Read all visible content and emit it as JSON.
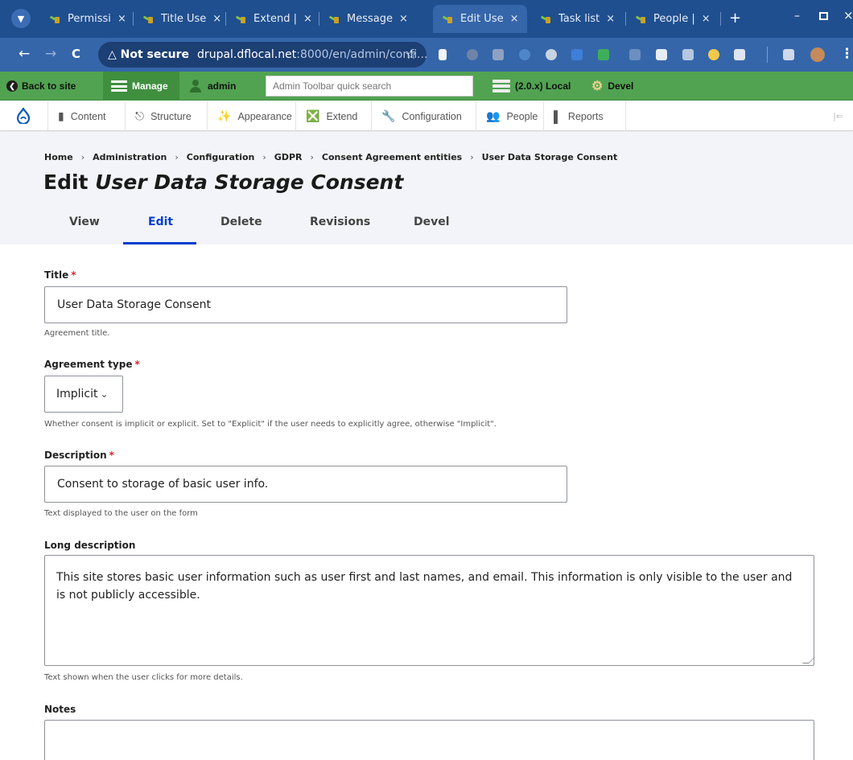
{
  "browser": {
    "tabs": [
      {
        "title": "Permissi",
        "active": false
      },
      {
        "title": "Title Use",
        "active": false
      },
      {
        "title": "Extend |",
        "active": false
      },
      {
        "title": "Message",
        "active": false
      },
      {
        "title": "Edit Use",
        "active": true
      },
      {
        "title": "Task list",
        "active": false
      },
      {
        "title": "People |",
        "active": false
      }
    ],
    "close_glyph": "×",
    "new_tab": "+",
    "security_label": "Not secure",
    "url_host": "drupal.dflocal.net",
    "url_rest": ":8000/en/admin/confi...",
    "bookmark_glyph": "☆",
    "back_glyph": "←",
    "forward_glyph": "→",
    "reload_glyph": "C"
  },
  "admin_toolbar": {
    "back_to_site": "Back to site",
    "manage": "Manage",
    "user": "admin",
    "search_placeholder": "Admin Toolbar quick search",
    "environment": "(2.0.x) Local",
    "devel": "Devel"
  },
  "admin_menu": {
    "items": [
      "Content",
      "Structure",
      "Appearance",
      "Extend",
      "Configuration",
      "People",
      "Reports"
    ]
  },
  "breadcrumb": [
    "Home",
    "Administration",
    "Configuration",
    "GDPR",
    "Consent Agreement entities",
    "User Data Storage Consent"
  ],
  "breadcrumb_sep": "›",
  "page": {
    "title_prefix": "Edit ",
    "title_entity": "User Data Storage Consent"
  },
  "tabs": [
    "View",
    "Edit",
    "Delete",
    "Revisions",
    "Devel"
  ],
  "active_tab": "Edit",
  "form": {
    "title": {
      "label": "Title",
      "required_mark": "*",
      "value": "User Data Storage Consent",
      "help": "Agreement title."
    },
    "agreement_type": {
      "label": "Agreement type",
      "required_mark": "*",
      "value": "Implicit",
      "help": "Whether consent is implicit or explicit. Set to \"Explicit\" if the user needs to explicitly agree, otherwise \"Implicit\"."
    },
    "description": {
      "label": "Description",
      "required_mark": "*",
      "value": "Consent to storage of basic user info.",
      "help": "Text displayed to the user on the form"
    },
    "long_description": {
      "label": "Long description",
      "value": "This site stores basic user information such as user first and last names, and email. This information is only visible to the user and is not publicly accessible.",
      "help": "Text shown when the user clicks for more details."
    },
    "notes": {
      "label": "Notes",
      "value": ""
    }
  },
  "colors": {
    "tabstrip": "#1f4f8f",
    "addressbar": "#3566aa",
    "admin_toolbar": "#51a351",
    "active_tab_accent": "#003ecc",
    "required": "#dc2323",
    "header_bg": "#f3f4f9"
  }
}
